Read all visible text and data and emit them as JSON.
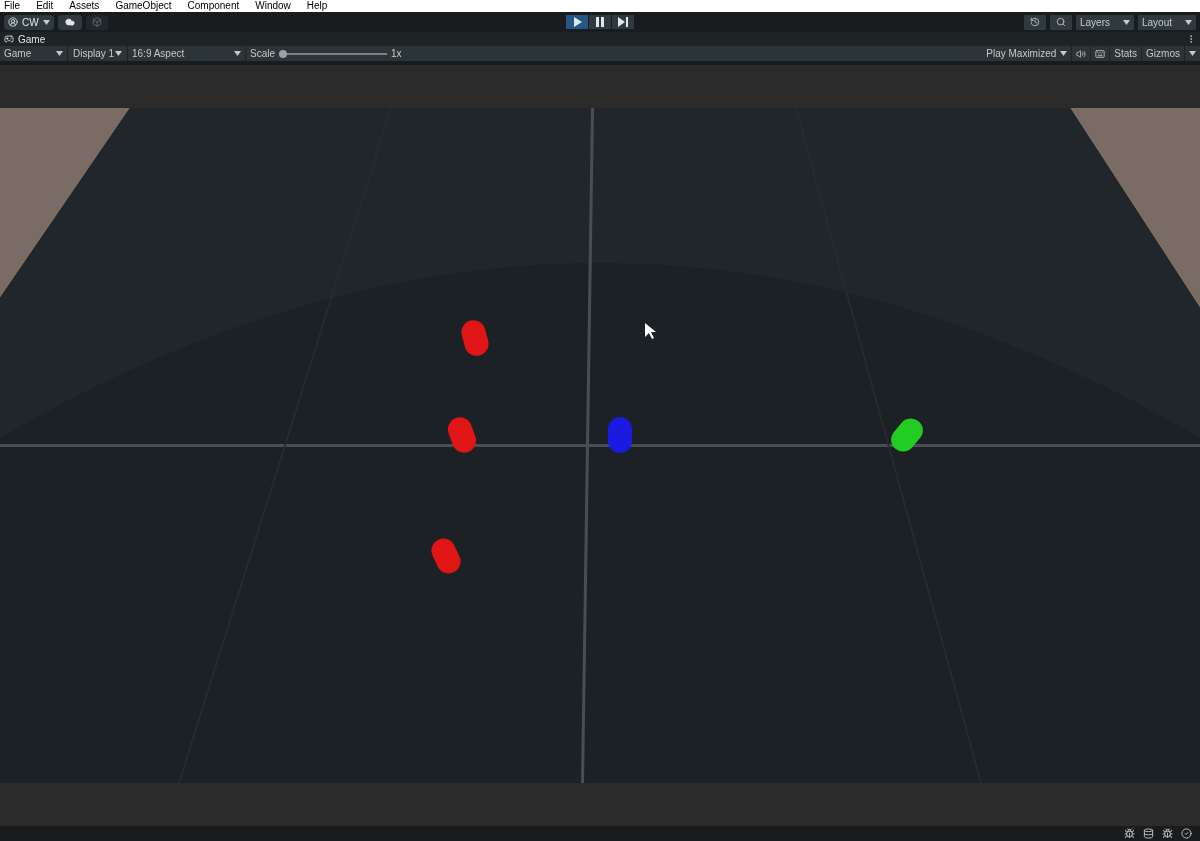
{
  "menu_bar": [
    "File",
    "Edit",
    "Assets",
    "GameObject",
    "Component",
    "Window",
    "Help"
  ],
  "toolbar": {
    "account": "CW",
    "play_controls": [
      {
        "kind": "play",
        "selected": true
      },
      {
        "kind": "pause",
        "selected": false
      },
      {
        "kind": "step",
        "selected": false
      }
    ],
    "layers": "Layers",
    "layout": "Layout"
  },
  "tab": {
    "label": "Game"
  },
  "game_toolbar": {
    "view": "Game",
    "display": "Display 1",
    "aspect": "16:9 Aspect",
    "scale_label": "Scale",
    "scale": {
      "level": 0.0
    },
    "scale_value": "1x",
    "play_mode": "Play Maximized",
    "stats": "Stats",
    "gizmos": "Gizmos"
  }
}
